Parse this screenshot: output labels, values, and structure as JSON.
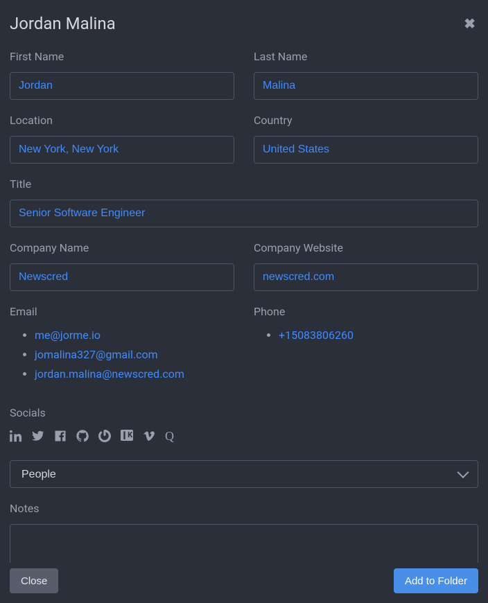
{
  "header": {
    "title": "Jordan Malina"
  },
  "fields": {
    "first_name": {
      "label": "First Name",
      "value": "Jordan"
    },
    "last_name": {
      "label": "Last Name",
      "value": "Malina"
    },
    "location": {
      "label": "Location",
      "value": "New York, New York"
    },
    "country": {
      "label": "Country",
      "value": "United States"
    },
    "title": {
      "label": "Title",
      "value": "Senior Software Engineer"
    },
    "company_name": {
      "label": "Company Name",
      "value": "Newscred"
    },
    "company_website": {
      "label": "Company Website",
      "value": "newscred.com"
    }
  },
  "email": {
    "label": "Email",
    "items": [
      "me@jorme.io",
      "jomalina327@gmail.com",
      "jordan.malina@newscred.com"
    ]
  },
  "phone": {
    "label": "Phone",
    "items": [
      "+15083806260"
    ]
  },
  "socials": {
    "label": "Socials",
    "icons": [
      "linkedin",
      "twitter",
      "facebook",
      "github",
      "gravatar",
      "klout",
      "vimeo",
      "quora"
    ]
  },
  "folder_select": {
    "selected": "People"
  },
  "notes": {
    "label": "Notes",
    "value": ""
  },
  "footer": {
    "close": "Close",
    "add": "Add to Folder"
  }
}
